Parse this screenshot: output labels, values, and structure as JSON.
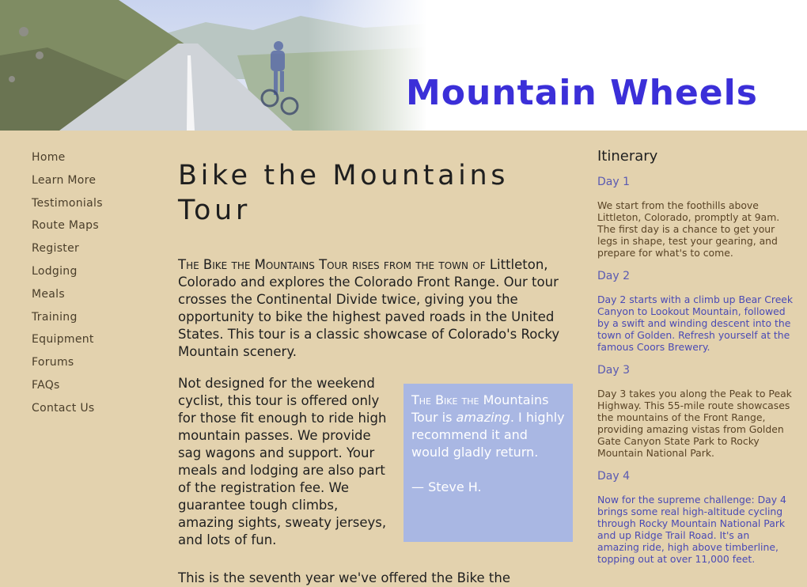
{
  "header": {
    "logo_text": "Mountain Wheels",
    "photo_icon": "cyclist-road-photo",
    "colors": {
      "logo": "#3b2fd8",
      "page_bg": "#e3d2ae",
      "quote_bg": "#a9b7e3"
    }
  },
  "nav": {
    "items": [
      {
        "label": "Home"
      },
      {
        "label": "Learn More"
      },
      {
        "label": "Testimonials"
      },
      {
        "label": "Route Maps"
      },
      {
        "label": "Register"
      },
      {
        "label": "Lodging"
      },
      {
        "label": "Meals"
      },
      {
        "label": "Training"
      },
      {
        "label": "Equipment"
      },
      {
        "label": "Forums"
      },
      {
        "label": "FAQs"
      },
      {
        "label": "Contact Us"
      }
    ]
  },
  "main": {
    "title": "Bike the Mountains Tour",
    "intro_lead": "The Bike the Mountains Tour rises from the town of",
    "intro_rest": " Littleton, Colorado and explores the Colorado Front Range. Our tour crosses the Continental Divide twice, giving you the opportunity to bike the highest paved roads in the United States. This tour is a classic showcase of Colorado's Rocky Mountain scenery.",
    "para2": "Not designed for the weekend cyclist, this tour is offered only for those fit enough to ride high mountain passes. We provide sag wagons and support. Your meals and lodging are also part of the registration fee. We guarantee tough climbs, amazing sights, sweaty jerseys, and lots of fun.",
    "quote": {
      "lead": "The Bike the",
      "line2": " Mountains Tour is ",
      "emphasis": "amazing",
      "rest": ". I highly recommend it and would gladly return.",
      "author": "— Steve H."
    },
    "para3": "This is the seventh year we've offered the Bike the"
  },
  "sidebar": {
    "title": "Itinerary",
    "days": [
      {
        "heading": "Day 1",
        "text": "We start from the foothills above Littleton, Colorado, promptly at 9am. The first day is a chance to get your legs in shape, test your gearing, and prepare for what's to come."
      },
      {
        "heading": "Day 2",
        "text": "Day 2 starts with a climb up Bear Creek Canyon to Lookout Mountain, followed by a swift and winding descent into the town of Golden. Refresh yourself at the famous Coors Brewery."
      },
      {
        "heading": "Day 3",
        "text": "Day 3 takes you along the Peak to Peak Highway. This 55-mile route showcases the mountains of the Front Range, providing amazing vistas from Golden Gate Canyon State Park to Rocky Mountain National Park."
      },
      {
        "heading": "Day 4",
        "text": "Now for the supreme challenge: Day 4 brings some real high-altitude cycling through Rocky Mountain National Park and up Ridge Trail Road. It's an amazing ride, high above timberline, topping out at over 11,000 feet."
      }
    ]
  }
}
